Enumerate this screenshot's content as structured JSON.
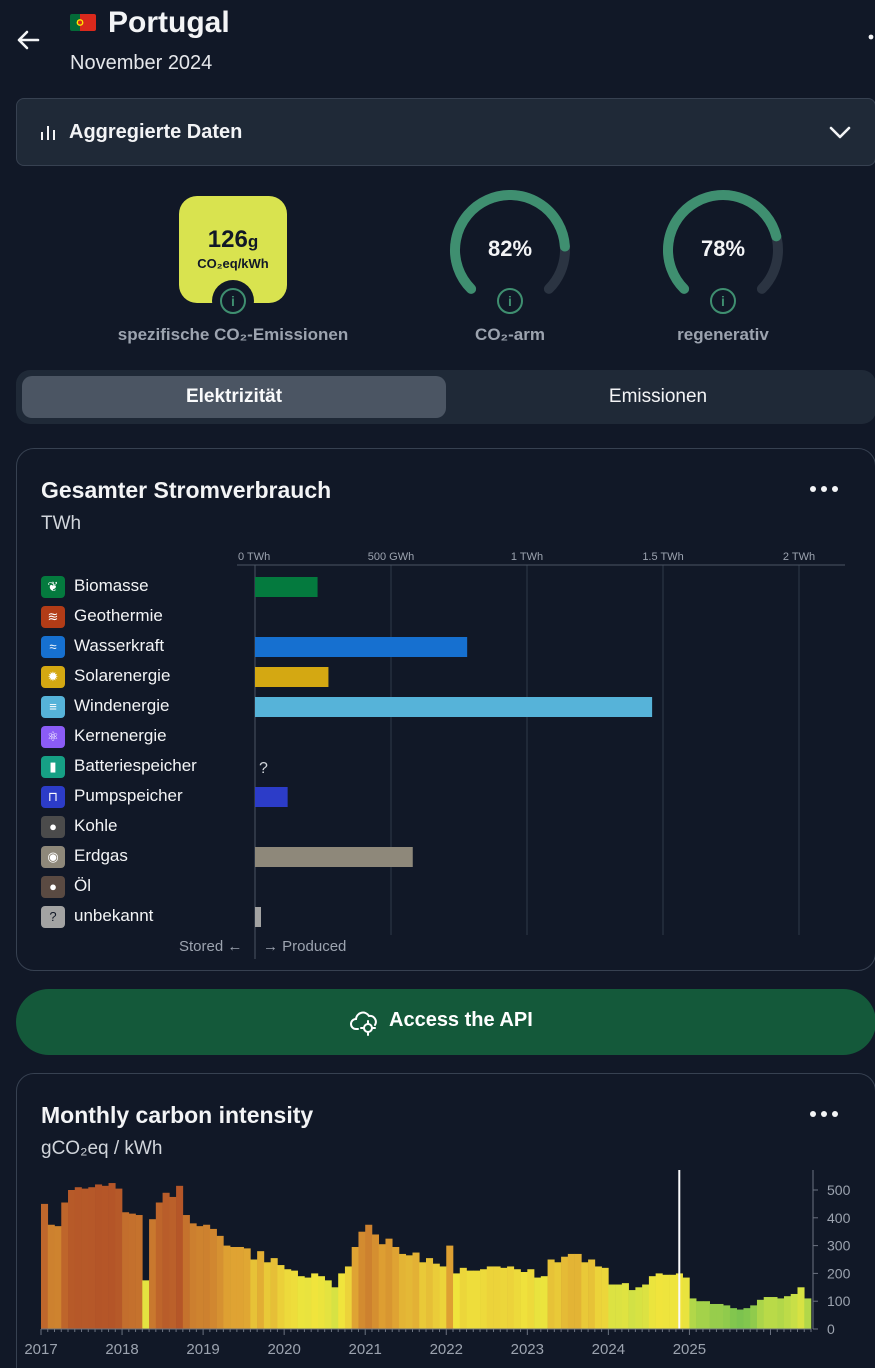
{
  "header": {
    "title": "Portugal",
    "subtitle": "November 2024",
    "flag_colors": [
      "#046a38",
      "#da291c",
      "#ffe900"
    ]
  },
  "aggregate": {
    "label": "Aggregierte Daten",
    "icon": "bar-chart-icon",
    "expand_icon": "chevron-down-icon"
  },
  "metrics": {
    "co2": {
      "value": "126",
      "value_unit": "g",
      "unit": "CO₂eq/kWh",
      "label": "spezifische CO₂-Emissionen",
      "color": "#d9e34f"
    },
    "low_carbon": {
      "value": "82%",
      "fraction": 0.82,
      "label": "CO₂-arm"
    },
    "renewable": {
      "value": "78%",
      "fraction": 0.78,
      "label": "regenerativ"
    },
    "gauge_color": "#3f8f70"
  },
  "tabs": [
    {
      "label": "Elektrizität",
      "active": true
    },
    {
      "label": "Emissionen",
      "active": false
    }
  ],
  "consumption": {
    "title": "Gesamter Stromverbrauch",
    "unit": "TWh",
    "stored_label": "Stored ←",
    "produced_label": "→ Produced"
  },
  "api_button": {
    "label": "Access the API",
    "icon": "cloud-gear-icon"
  },
  "carbon": {
    "title": "Monthly carbon intensity",
    "unit": "gCO₂eq / kWh"
  },
  "chart_data": [
    {
      "type": "bar",
      "orientation": "horizontal",
      "title": "Gesamter Stromverbrauch",
      "ylabel": "TWh",
      "x_ticks": [
        "0 TWh",
        "500 GWh",
        "1 TWh",
        "1.5 TWh",
        "2 TWh"
      ],
      "xlim": [
        0,
        2.1
      ],
      "grid": true,
      "categories": [
        {
          "name": "Biomasse",
          "value": 0.23,
          "color": "#047a3e",
          "icon": "leaf-icon"
        },
        {
          "name": "Geothermie",
          "value": 0,
          "color": "#b23c17",
          "icon": "heat-waves-icon"
        },
        {
          "name": "Wasserkraft",
          "value": 0.78,
          "color": "#1670d0",
          "icon": "water-waves-icon"
        },
        {
          "name": "Solarenergie",
          "value": 0.27,
          "color": "#d4a812",
          "icon": "sun-icon"
        },
        {
          "name": "Windenergie",
          "value": 1.46,
          "color": "#56b3d9",
          "icon": "wind-icon"
        },
        {
          "name": "Kernenergie",
          "value": 0,
          "color": "#8b5cf6",
          "icon": "atom-icon"
        },
        {
          "name": "Batteriespeicher",
          "value": null,
          "value_label": "?",
          "color": "#16a085",
          "icon": "battery-icon"
        },
        {
          "name": "Pumpspeicher",
          "value": 0.12,
          "color": "#2c3cc8",
          "icon": "pumped-storage-icon"
        },
        {
          "name": "Kohle",
          "value": 0,
          "color": "#4b4b4b",
          "icon": "coal-icon"
        },
        {
          "name": "Erdgas",
          "value": 0.58,
          "color": "#8e887a",
          "icon": "gas-flame-icon"
        },
        {
          "name": "Öl",
          "value": 0,
          "color": "#5a4a42",
          "icon": "oil-drop-icon"
        },
        {
          "name": "unbekannt",
          "value": 0.02,
          "color": "#a3a3a3",
          "icon": "question-icon"
        }
      ]
    },
    {
      "type": "bar",
      "title": "Monthly carbon intensity",
      "ylabel": "gCO₂eq / kWh",
      "ylim": [
        0,
        550
      ],
      "y_ticks": [
        0,
        100,
        200,
        300,
        400,
        500
      ],
      "x_ticks": [
        "2017",
        "2018",
        "2019",
        "2020",
        "2021",
        "2022",
        "2023",
        "2024",
        "2025"
      ],
      "start": "2017-01",
      "highlight_month": "2024-11",
      "values": [
        450,
        375,
        370,
        455,
        500,
        510,
        505,
        510,
        520,
        515,
        525,
        505,
        420,
        415,
        410,
        175,
        395,
        455,
        490,
        475,
        515,
        410,
        380,
        370,
        375,
        360,
        335,
        300,
        295,
        295,
        290,
        250,
        280,
        240,
        255,
        230,
        215,
        210,
        190,
        185,
        200,
        190,
        175,
        150,
        200,
        225,
        295,
        350,
        375,
        340,
        305,
        325,
        295,
        270,
        265,
        275,
        240,
        255,
        235,
        225,
        300,
        200,
        220,
        210,
        210,
        215,
        225,
        225,
        220,
        225,
        215,
        205,
        215,
        185,
        190,
        250,
        240,
        260,
        270,
        270,
        240,
        250,
        225,
        220,
        160,
        160,
        165,
        140,
        150,
        160,
        190,
        200,
        195,
        195,
        200,
        185,
        110,
        100,
        100,
        90,
        90,
        85,
        75,
        70,
        75,
        85,
        105,
        115,
        115,
        110,
        118,
        126,
        150,
        110
      ]
    }
  ]
}
